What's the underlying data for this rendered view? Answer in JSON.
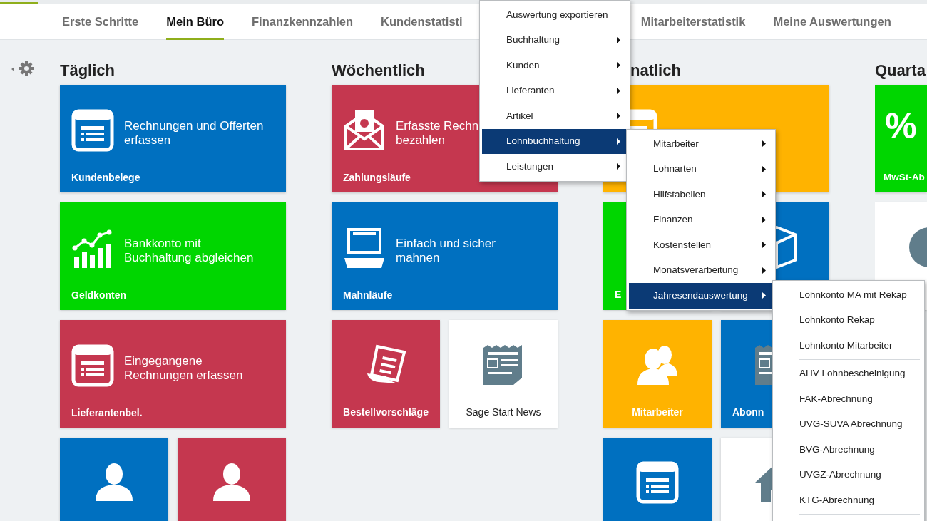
{
  "tabs": [
    {
      "label": "Erste Schritte",
      "selected": false
    },
    {
      "label": "Mein Büro",
      "selected": true
    },
    {
      "label": "Finanzkennzahlen",
      "selected": false
    },
    {
      "label": "Kundenstatisti",
      "selected": false
    },
    {
      "label": "Mitarbeiterstatistik",
      "selected": false
    },
    {
      "label": "Meine Auswertungen",
      "selected": false
    }
  ],
  "columns": [
    {
      "heading": "Täglich",
      "tiles": [
        {
          "kind": "wide",
          "color": "#0070c0",
          "lines": [
            "Rechnungen und Offerten",
            "erfassen"
          ],
          "label": "Kundenbelege"
        },
        {
          "kind": "wide",
          "color": "#00d600",
          "lines": [
            "Bankkonto mit",
            "Buchhaltung abgleichen"
          ],
          "label": "Geldkonten"
        },
        {
          "kind": "wide",
          "color": "#c5374f",
          "lines": [
            "Eingegangene",
            "Rechnungen erfassen"
          ],
          "label": "Lieferantenbel."
        },
        {
          "kind": "small",
          "color": "#0070c0"
        },
        {
          "kind": "small",
          "color": "#c5374f"
        }
      ]
    },
    {
      "heading": "Wöchentlich",
      "tiles": [
        {
          "kind": "wide",
          "color": "#c5374f",
          "lines": [
            "Erfasste Rechn",
            "bezahlen"
          ],
          "label": "Zahlungsläufe"
        },
        {
          "kind": "wide",
          "color": "#0070c0",
          "lines": [
            "Einfach und sicher",
            "mahnen"
          ],
          "label": "Mahnläufe"
        },
        {
          "kind": "small",
          "color": "#c5374f",
          "label": "Bestellvorschläge"
        },
        {
          "kind": "small",
          "color": "#ffffff",
          "label": "Sage Start News"
        }
      ]
    },
    {
      "heading": "natlich",
      "tiles": [
        {
          "kind": "wide",
          "color": "#ffb300"
        },
        {
          "kind": "small",
          "color": "#00d600",
          "label": "E",
          "clipped": true
        },
        {
          "kind": "small",
          "color": "#0070c0"
        },
        {
          "kind": "small",
          "color": "#ffb300",
          "label": "Mitarbeiter"
        },
        {
          "kind": "small",
          "color": "#0070c0",
          "label": "Abonn",
          "clipped": true
        },
        {
          "kind": "small",
          "color": "#0070c0"
        },
        {
          "kind": "small",
          "color": "#ffffff"
        }
      ]
    },
    {
      "heading": "Quarta",
      "tiles": [
        {
          "kind": "small",
          "color": "#00d600",
          "symbol": "%",
          "label": "MwSt-Ab",
          "clipped": true
        },
        {
          "kind": "small",
          "color": "#ffffff"
        }
      ]
    }
  ],
  "menus": [
    {
      "items": [
        {
          "kind": "item",
          "label": "Auswertung exportieren",
          "submenu": false,
          "selected": false
        },
        {
          "kind": "item",
          "label": "Buchhaltung",
          "submenu": true,
          "selected": false
        },
        {
          "kind": "item",
          "label": "Kunden",
          "submenu": true,
          "selected": false
        },
        {
          "kind": "item",
          "label": "Lieferanten",
          "submenu": true,
          "selected": false
        },
        {
          "kind": "item",
          "label": "Artikel",
          "submenu": true,
          "selected": false
        },
        {
          "kind": "item",
          "label": "Lohnbuchhaltung",
          "submenu": true,
          "selected": true
        },
        {
          "kind": "item",
          "label": "Leistungen",
          "submenu": true,
          "selected": false
        }
      ]
    },
    {
      "items": [
        {
          "kind": "item",
          "label": "Mitarbeiter",
          "submenu": true,
          "selected": false
        },
        {
          "kind": "item",
          "label": "Lohnarten",
          "submenu": true,
          "selected": false
        },
        {
          "kind": "item",
          "label": "Hilfstabellen",
          "submenu": true,
          "selected": false
        },
        {
          "kind": "item",
          "label": "Finanzen",
          "submenu": true,
          "selected": false
        },
        {
          "kind": "item",
          "label": "Kostenstellen",
          "submenu": true,
          "selected": false
        },
        {
          "kind": "item",
          "label": "Monatsverarbeitung",
          "submenu": true,
          "selected": false
        },
        {
          "kind": "item",
          "label": "Jahresendauswertung",
          "submenu": true,
          "selected": true
        }
      ]
    },
    {
      "items": [
        {
          "kind": "item",
          "label": "Lohnkonto MA mit Rekap",
          "submenu": false,
          "selected": false
        },
        {
          "kind": "item",
          "label": "Lohnkonto Rekap",
          "submenu": false,
          "selected": false
        },
        {
          "kind": "item",
          "label": "Lohnkonto Mitarbeiter",
          "submenu": false,
          "selected": false
        },
        {
          "kind": "separator"
        },
        {
          "kind": "item",
          "label": "AHV Lohnbescheinigung",
          "submenu": false,
          "selected": false
        },
        {
          "kind": "item",
          "label": "FAK-Abrechnung",
          "submenu": false,
          "selected": false
        },
        {
          "kind": "item",
          "label": "UVG-SUVA Abrechnung",
          "submenu": false,
          "selected": false
        },
        {
          "kind": "item",
          "label": "BVG-Abrechnung",
          "submenu": false,
          "selected": false
        },
        {
          "kind": "item",
          "label": "UVGZ-Abrechnung",
          "submenu": false,
          "selected": false
        },
        {
          "kind": "item",
          "label": "KTG-Abrechnung",
          "submenu": false,
          "selected": false
        },
        {
          "kind": "separator"
        }
      ]
    }
  ]
}
